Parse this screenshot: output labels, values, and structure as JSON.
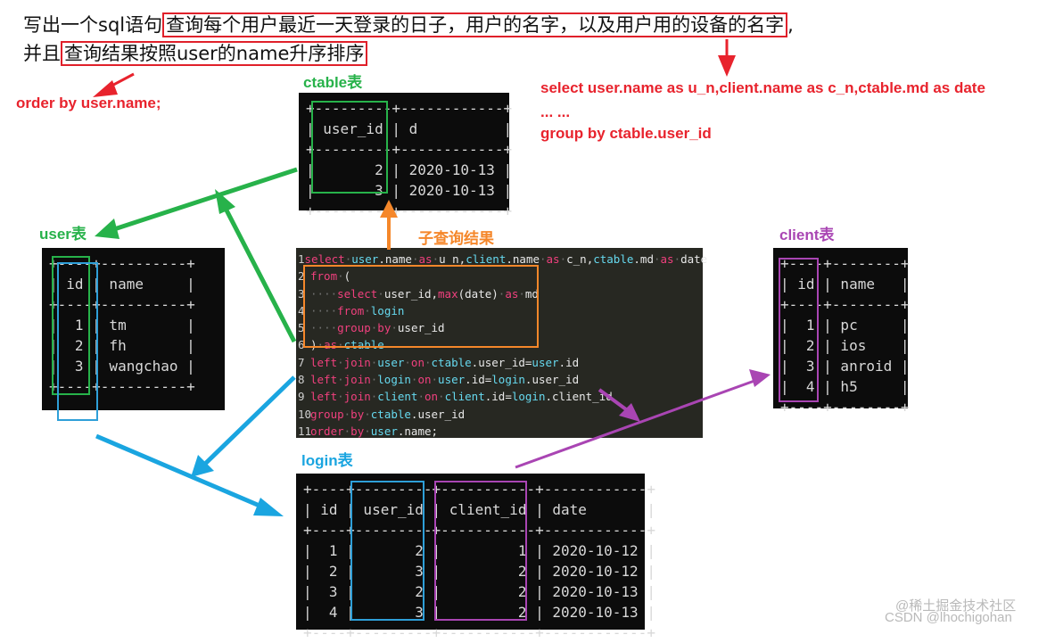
{
  "question": {
    "line1_pre": "写出一个sql语句",
    "line1_hl": "查询每个用户最近一天登录的日子，用户的名字，以及用户用的设备的名字",
    "line1_post": ",",
    "line2_pre": "并且",
    "line2_hl": "查询结果按照user的name升序排序"
  },
  "notes": {
    "order_by": "order by user.name;",
    "select_line": "select user.name as u_n,client.name as c_n,ctable.md as date",
    "ellipsis": "... ...",
    "group_by": "group by ctable.user_id"
  },
  "labels": {
    "ctable": "ctable表",
    "user": "user表",
    "client": "client表",
    "login": "login表",
    "subquery": "子查询结果"
  },
  "tables": {
    "ctable": "+---------+------------+\n| user_id | d          |\n+---------+------------+\n|       2 | 2020-10-13 |\n|       3 | 2020-10-13 |\n+---------+------------+",
    "user": "+----+----------+\n| id | name     |\n+----+----------+\n|  1 | tm       |\n|  2 | fh       |\n|  3 | wangchao |\n+----+----------+",
    "client": "+----+--------+\n| id | name   |\n+----+--------+\n|  1 | pc     |\n|  2 | ios    |\n|  3 | anroid |\n|  4 | h5     |\n+----+--------+",
    "login": "+----+---------+-----------+------------+\n| id | user_id | client_id | date       |\n+----+---------+-----------+------------+\n|  1 |       2 |         1 | 2020-10-12 |\n|  2 |       3 |         2 | 2020-10-12 |\n|  3 |       2 |         2 | 2020-10-13 |\n|  4 |       3 |         2 | 2020-10-13 |\n+----+---------+-----------+------------+"
  },
  "code_lines": [
    {
      "n": "1",
      "text": "select·user.name·as·u_n,client.name·as·c_n,ctable.md·as·date"
    },
    {
      "n": "2",
      "text": "from·("
    },
    {
      "n": "3",
      "text": "····select·user_id,max(date)·as·md"
    },
    {
      "n": "4",
      "text": "····from·login"
    },
    {
      "n": "5",
      "text": "····group·by·user_id"
    },
    {
      "n": "6",
      "text": ")·as·ctable"
    },
    {
      "n": "7",
      "text": "left·join·user·on·ctable.user_id=user.id"
    },
    {
      "n": "8",
      "text": "left·join·login·on·user.id=login.user_id"
    },
    {
      "n": "9",
      "text": "left·join·client·on·client.id=login.client_id"
    },
    {
      "n": "10",
      "text": "group·by·ctable.user_id"
    },
    {
      "n": "11",
      "text": "order·by·user.name;"
    }
  ],
  "watermark": {
    "line1": "@稀土掘金技术社区",
    "line2": "CSDN @lhochigohan"
  },
  "colors": {
    "red": "#e8232d",
    "green": "#27b24a",
    "orange": "#f5872a",
    "purple": "#a945b3",
    "blue": "#1aa5e0",
    "lightblue": "#2e9fd8"
  }
}
